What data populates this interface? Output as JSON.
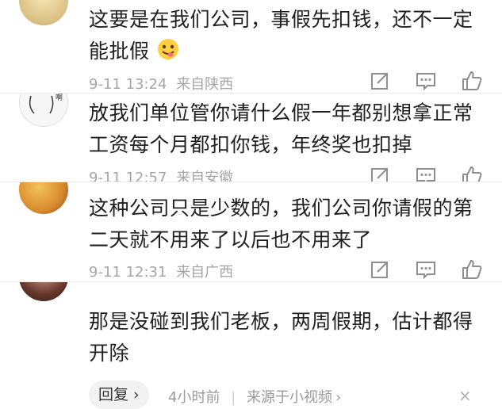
{
  "comments": [
    {
      "text": "这要是在我们公司，事假先扣钱，还不一定能批假",
      "time": "9-11 13:24",
      "location": "来自陕西",
      "emoji_icon": "face-savoring-emoji-icon"
    },
    {
      "text": "放我们单位管你请什么假一年都别想拿正常工资每个月都扣你钱，年终奖也扣掉",
      "time": "9-11 12:57",
      "location": "来自安徽"
    },
    {
      "text": "这种公司只是少数的，我们公司你请假的第二天就不用来了以后也不用来了",
      "time": "9-11 12:31",
      "location": "来自广西"
    },
    {
      "text": "那是没碰到我们老板，两周假期，估计都得开除",
      "reply_label": "回复",
      "reply_arrow": "›",
      "time_ago": "4小时前",
      "separator": "|",
      "source": "来源于小视频",
      "source_arrow": "›",
      "close": "×"
    }
  ],
  "icons": {
    "share": "share-icon",
    "comment": "comment-icon",
    "like": "thumbs-up-icon",
    "close": "close-icon"
  },
  "colors": {
    "meta": "#a6a6a6",
    "text": "#1f1f1f",
    "reply_bg": "#f2f2f2"
  }
}
